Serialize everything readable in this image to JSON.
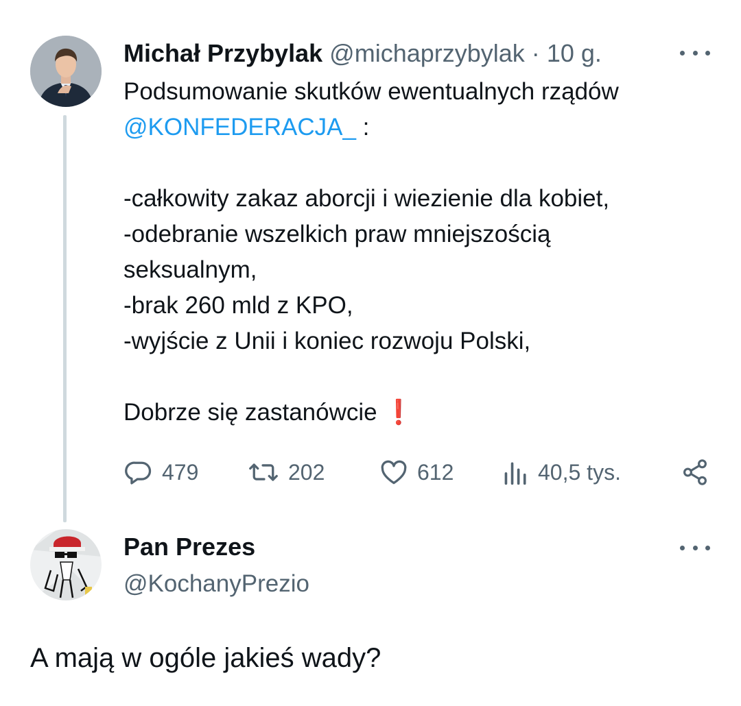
{
  "tweet": {
    "author_name": "Michał Przybylak",
    "handle": "@michaprzybylak",
    "separator": "·",
    "time": "10 g.",
    "lines": {
      "l1": "Podsumowanie skutków ewentualnych rządów",
      "mention": "@KONFEDERACJA_",
      "mention_suffix": " :",
      "b1": "-całkowity zakaz aborcji i wiezienie dla kobiet,",
      "b2a": "-odebranie wszelkich praw mniejszością",
      "b2b": "seksualnym,",
      "b3": "-brak 260 mld z KPO,",
      "b4": "-wyjście z Unii i koniec rozwoju Polski,",
      "closing": "Dobrze się zastanówcie ",
      "closing_emoji": "❗"
    },
    "stats": {
      "replies": "479",
      "retweets": "202",
      "likes": "612",
      "views": "40,5 tys."
    },
    "icons": {
      "reply": "reply-icon",
      "retweet": "retweet-icon",
      "like": "heart-icon",
      "views": "views-icon",
      "share": "share-icon",
      "more": "more-icon"
    }
  },
  "reply": {
    "author_name": "Pan Prezes",
    "handle": "@KochanyPrezio",
    "text": "A mają w ogóle jakieś wady?"
  },
  "colors": {
    "text": "#0f1419",
    "secondary": "#536471",
    "link": "#1d9bf0",
    "thread_line": "#cfd9de",
    "emoji_red": "#d0202e"
  }
}
